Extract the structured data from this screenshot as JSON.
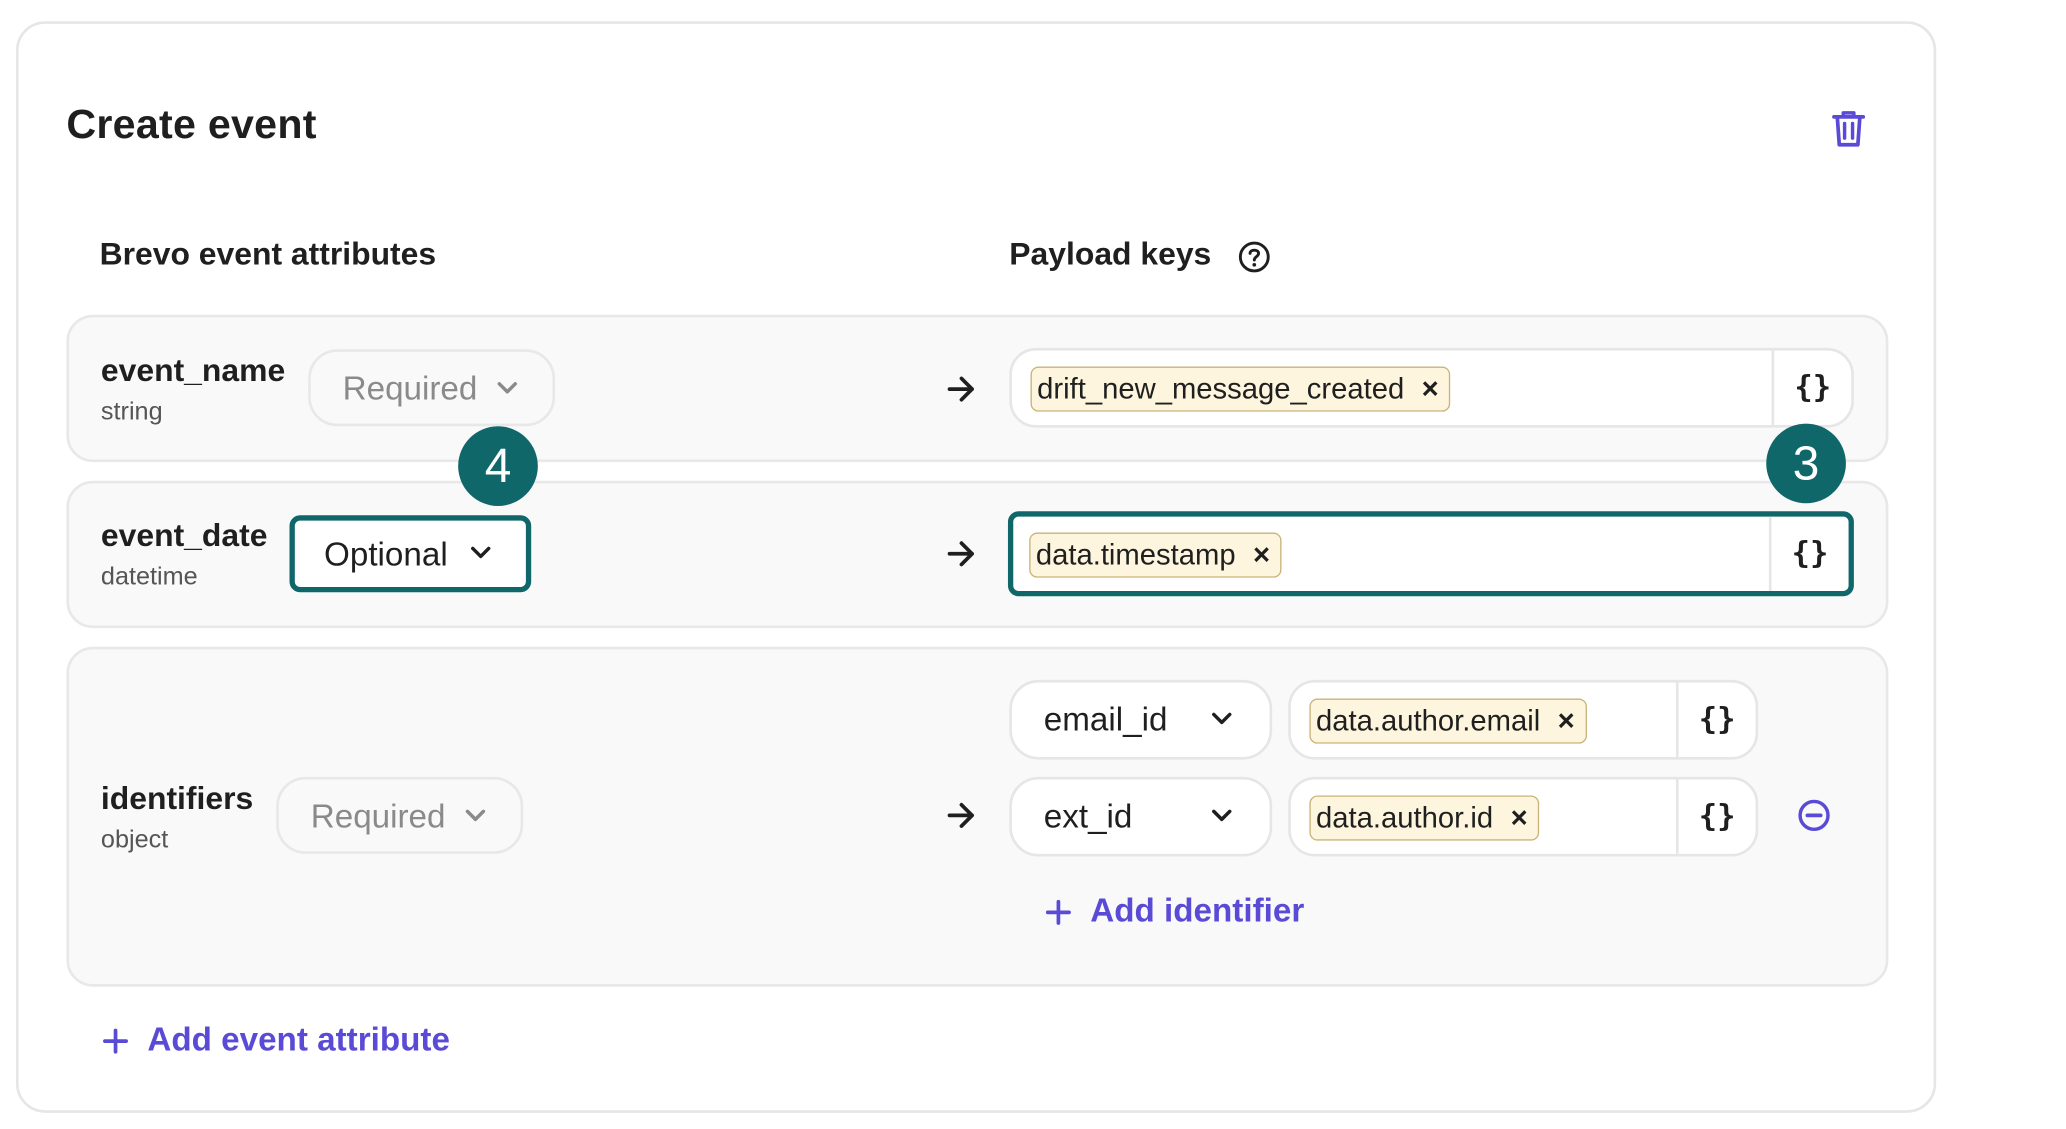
{
  "panel": {
    "title": "Create event"
  },
  "columns": {
    "attributes": "Brevo event attributes",
    "payload": "Payload keys"
  },
  "rows": [
    {
      "name": "event_name",
      "type": "string",
      "requirement": "Required",
      "chip": "drift_new_message_created",
      "braces": "{}"
    },
    {
      "name": "event_date",
      "type": "datetime",
      "requirement": "Optional",
      "chip": "data.timestamp",
      "braces": "{}"
    },
    {
      "name": "identifiers",
      "type": "object",
      "requirement": "Required",
      "identifiers": [
        {
          "key": "email_id",
          "chip": "data.author.email",
          "braces": "{}"
        },
        {
          "key": "ext_id",
          "chip": "data.author.id",
          "braces": "{}"
        }
      ],
      "add_identifier": "Add identifier"
    }
  ],
  "chip_close": "×",
  "badges": {
    "step4": "4",
    "step3": "3"
  },
  "add_event_attribute": "Add event attribute",
  "colors": {
    "accent_teal": "#10676a",
    "link_purple": "#5a4bd6",
    "chip_bg": "#fdf5dd"
  },
  "icons": [
    "trash-icon",
    "help-circle-icon",
    "arrow-right-icon",
    "chevron-down-icon",
    "plus-icon",
    "minus-circle-icon"
  ]
}
